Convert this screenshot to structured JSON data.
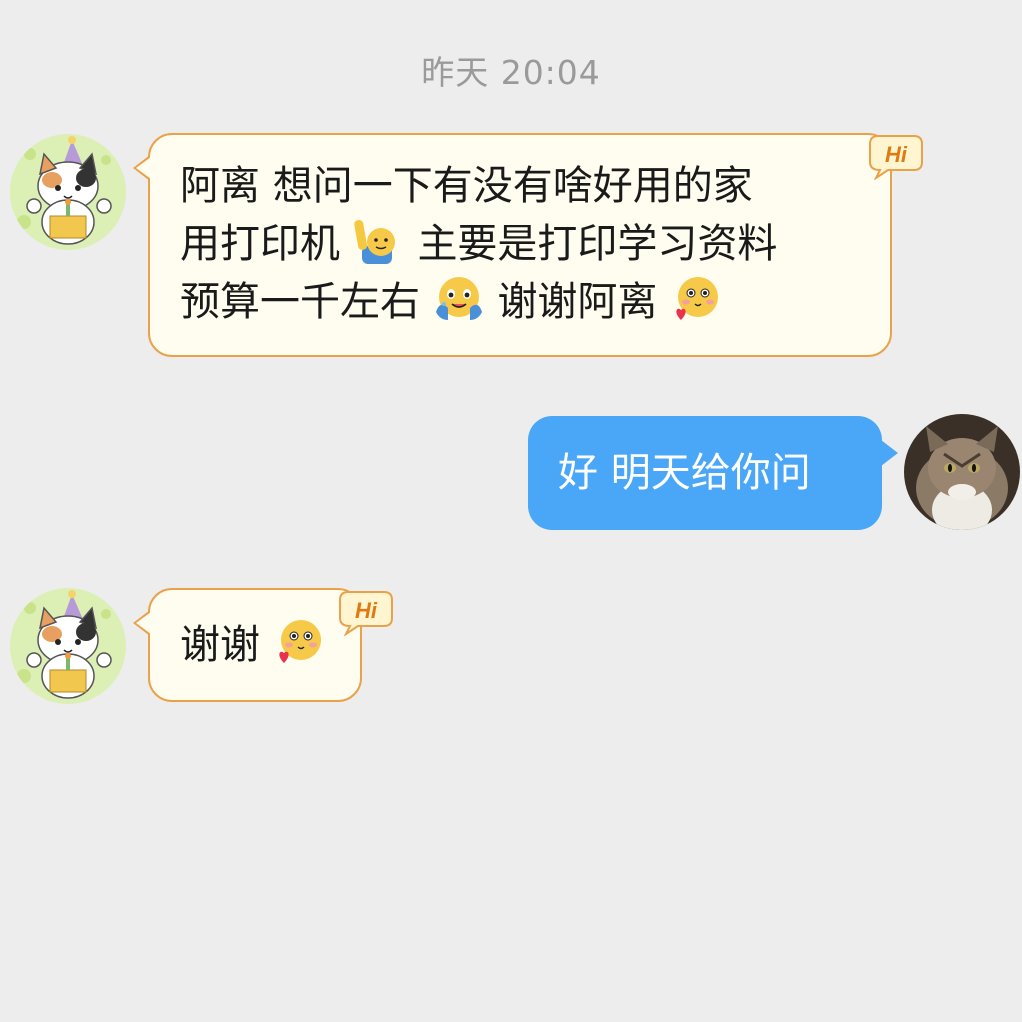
{
  "timestamp": "昨天 20:04",
  "messages": [
    {
      "sender": "other",
      "lines": [
        {
          "text_a": "阿离 想问一下有没有啥好用的家"
        },
        {
          "text_a": "用打印机",
          "emoji_1": "raising-hand-emoji",
          "text_b": "主要是打印学习资料"
        },
        {
          "text_a": "预算一千左右",
          "emoji_1": "hugging-emoji",
          "text_b": "谢谢阿离",
          "emoji_2": "blushing-heart-emoji"
        }
      ]
    },
    {
      "sender": "me",
      "text": "好 明天给你问"
    },
    {
      "sender": "other",
      "text": "谢谢",
      "emoji": "blushing-heart-emoji"
    }
  ],
  "badge": {
    "label": "Hi"
  },
  "colors": {
    "background": "#ededed",
    "incoming_bubble": "#fffdf0",
    "incoming_border": "#e9a24a",
    "outgoing_bubble": "#4aa7f7",
    "timestamp": "#9a9a9a"
  }
}
